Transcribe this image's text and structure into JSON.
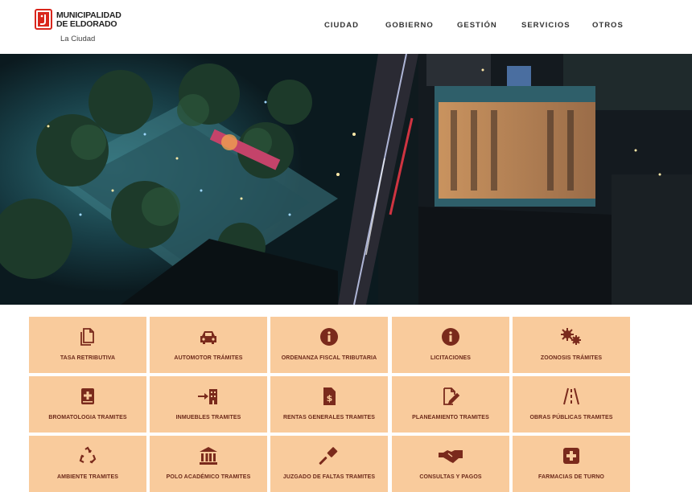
{
  "brand": {
    "name_line1": "MUNICIPALIDAD",
    "name_line2": "DE ELDORADO",
    "subtitle": "La Ciudad",
    "logo_icon": "municipal-shield-logo",
    "logo_color": "#d9261c"
  },
  "nav": {
    "items": [
      {
        "label": "CIUDAD"
      },
      {
        "label": "GOBIERNO"
      },
      {
        "label": "GESTIÓN"
      },
      {
        "label": "SERVICIOS"
      },
      {
        "label": "OTROS"
      }
    ]
  },
  "hero": {
    "image": "aerial-night-city-photo"
  },
  "tiles": {
    "background": "#f9cb9c",
    "text_color": "#6d2a1a",
    "icon_color": "#7a2a1c",
    "items": [
      {
        "label": "TASA RETRIBUTIVA",
        "icon": "documents-icon"
      },
      {
        "label": "AUTOMOTOR TRÁMITES",
        "icon": "car-icon"
      },
      {
        "label": "ORDENANZA FISCAL TRIBUTARIA",
        "icon": "info-icon"
      },
      {
        "label": "LICITACIONES",
        "icon": "info-icon"
      },
      {
        "label": "ZOONOSIS TRÁMITES",
        "icon": "virus-icon"
      },
      {
        "label": "BROMATOLOGIA TRAMITES",
        "icon": "medical-book-icon"
      },
      {
        "label": "INMUEBLES TRAMITES",
        "icon": "building-arrow-icon"
      },
      {
        "label": "RENTAS GENERALES TRAMITES",
        "icon": "invoice-dollar-icon"
      },
      {
        "label": "PLANEAMIENTO TRAMITES",
        "icon": "file-edit-icon"
      },
      {
        "label": "OBRAS PÚBLICAS TRAMITES",
        "icon": "road-icon"
      },
      {
        "label": "AMBIENTE TRAMITES",
        "icon": "recycle-icon"
      },
      {
        "label": "POLO ACADÉMICO TRAMITES",
        "icon": "landmark-icon"
      },
      {
        "label": "JUZGADO DE FALTAS TRAMITES",
        "icon": "gavel-icon"
      },
      {
        "label": "CONSULTAS Y PAGOS",
        "icon": "handshake-icon"
      },
      {
        "label": "FARMACIAS DE TURNO",
        "icon": "medical-cross-icon"
      }
    ]
  }
}
